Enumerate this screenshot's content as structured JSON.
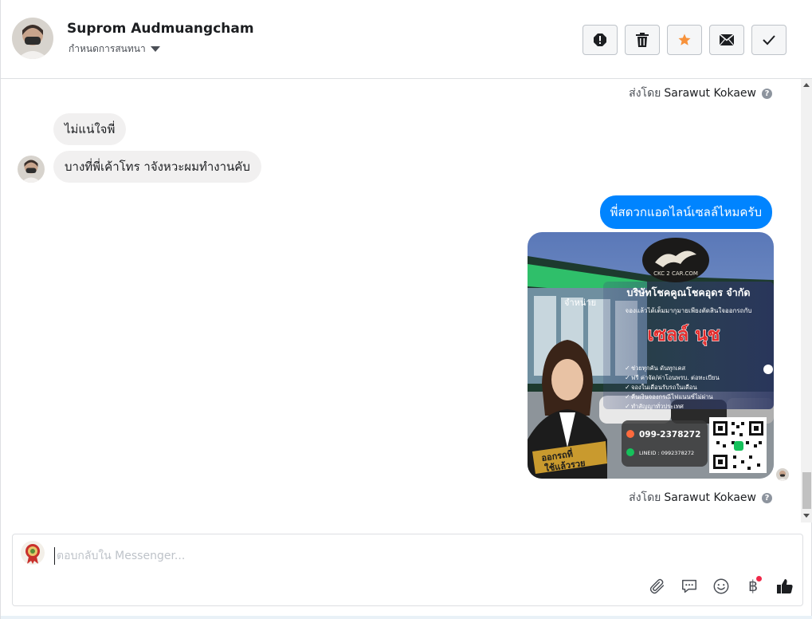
{
  "header": {
    "contact_name": "Suprom Audmuangcham",
    "subtitle": "กำหนดการสนทนา",
    "actions": [
      {
        "name": "report-button",
        "icon": "exclamation-icon"
      },
      {
        "name": "delete-button",
        "icon": "trash-icon"
      },
      {
        "name": "star-button",
        "icon": "star-icon",
        "color": "#f7923b"
      },
      {
        "name": "mark-unread-button",
        "icon": "envelope-icon"
      },
      {
        "name": "mark-done-button",
        "icon": "check-icon"
      }
    ]
  },
  "messages": {
    "sent_by_prefix": "ส่งโดย",
    "sent_by_top": "Sarawut Kokaew",
    "incoming": [
      {
        "text": "ไม่แน่ใจพี่"
      },
      {
        "text": "บางที่พี่เค้าโทร าจังหวะผมทำงานคับ"
      }
    ],
    "outgoing": {
      "text": "พี่สดวกแอดไลน์เซลล์ไหมครับ"
    },
    "card": {
      "logo": "CKC 2 CAR.COM",
      "company": "บริษัทโชคคูณโชคอุดร จำกัด",
      "tagline": "จองแล้วได้เต็มมากุมายเพียงตัดสินใจออกรถกับ",
      "sales_name": "เซลล์ นุช",
      "bullets": [
        "ช่วยทุกคัน ดันทุกเคส",
        "ฟรี ค่าจัด/ค่าโอนพรบ. ต่อทะเบียน",
        "จองในเดือนรับรถในเดือน",
        "คืนเงินจองกรณีไฟแนนซ์ไม่ผ่าน",
        "ทำสัญญาทั่วประเทศ"
      ],
      "phone": "099-2378272",
      "line_id": "LINEID : 0992378272",
      "shop_sign": "จำหน่าย",
      "ribbon": "ใช้แล้วรวย",
      "ribbon_top": "ออกรถที่"
    },
    "sent_by_bottom": "Sarawut Kokaew"
  },
  "composer": {
    "placeholder": "ตอบกลับใน Messenger...",
    "value": "",
    "tools": [
      "paperclip-icon",
      "chat-icon",
      "smiley-icon",
      "baht-icon",
      "thumbs-up-icon"
    ],
    "baht_symbol": "฿"
  },
  "colors": {
    "accent": "#0084ff",
    "star": "#f7923b",
    "like": "#1c1e21"
  }
}
